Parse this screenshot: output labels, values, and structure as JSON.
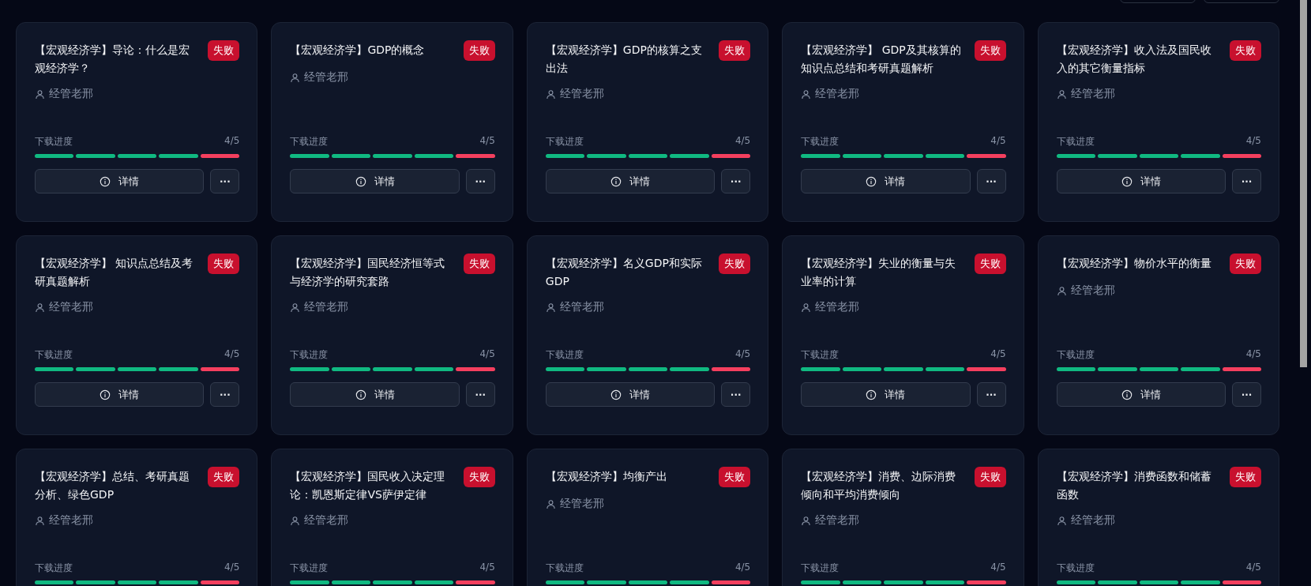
{
  "toolbar": {
    "buttons": [
      {
        "kind": "outline"
      },
      {
        "kind": "outline"
      }
    ]
  },
  "cards": [
    {
      "title": "【宏观经济学】导论：什么是宏观经济学？",
      "failed": true,
      "status_label": "失败",
      "author": "经管老邢",
      "progress_label": "下载进度",
      "progress_text": "4/5",
      "segments": [
        {
          "failed": false
        },
        {
          "failed": false
        },
        {
          "failed": false
        },
        {
          "failed": false
        },
        {
          "failed": true
        }
      ],
      "details_label": "详情",
      "more_label": "···"
    },
    {
      "title": "【宏观经济学】GDP的概念",
      "failed": true,
      "status_label": "失败",
      "author": "经管老邢",
      "progress_label": "下载进度",
      "progress_text": "4/5",
      "segments": [
        {
          "failed": false
        },
        {
          "failed": false
        },
        {
          "failed": false
        },
        {
          "failed": false
        },
        {
          "failed": true
        }
      ],
      "details_label": "详情",
      "more_label": "···"
    },
    {
      "title": "【宏观经济学】GDP的核算之支出法",
      "failed": true,
      "status_label": "失败",
      "author": "经管老邢",
      "progress_label": "下载进度",
      "progress_text": "4/5",
      "segments": [
        {
          "failed": false
        },
        {
          "failed": false
        },
        {
          "failed": false
        },
        {
          "failed": false
        },
        {
          "failed": true
        }
      ],
      "details_label": "详情",
      "more_label": "···"
    },
    {
      "title": "【宏观经济学】 GDP及其核算的知识点总结和考研真题解析",
      "failed": true,
      "status_label": "失败",
      "author": "经管老邢",
      "progress_label": "下载进度",
      "progress_text": "4/5",
      "segments": [
        {
          "failed": false
        },
        {
          "failed": false
        },
        {
          "failed": false
        },
        {
          "failed": false
        },
        {
          "failed": true
        }
      ],
      "details_label": "详情",
      "more_label": "···"
    },
    {
      "title": "【宏观经济学】收入法及国民收入的其它衡量指标",
      "failed": true,
      "status_label": "失败",
      "author": "经管老邢",
      "progress_label": "下载进度",
      "progress_text": "4/5",
      "segments": [
        {
          "failed": false
        },
        {
          "failed": false
        },
        {
          "failed": false
        },
        {
          "failed": false
        },
        {
          "failed": true
        }
      ],
      "details_label": "详情",
      "more_label": "···"
    },
    {
      "title": "【宏观经济学】 知识点总结及考研真题解析",
      "failed": true,
      "status_label": "失败",
      "author": "经管老邢",
      "progress_label": "下载进度",
      "progress_text": "4/5",
      "segments": [
        {
          "failed": false
        },
        {
          "failed": false
        },
        {
          "failed": false
        },
        {
          "failed": false
        },
        {
          "failed": true
        }
      ],
      "details_label": "详情",
      "more_label": "···"
    },
    {
      "title": "【宏观经济学】国民经济恒等式与经济学的研究套路",
      "failed": true,
      "status_label": "失败",
      "author": "经管老邢",
      "progress_label": "下载进度",
      "progress_text": "4/5",
      "segments": [
        {
          "failed": false
        },
        {
          "failed": false
        },
        {
          "failed": false
        },
        {
          "failed": false
        },
        {
          "failed": true
        }
      ],
      "details_label": "详情",
      "more_label": "···"
    },
    {
      "title": "【宏观经济学】名义GDP和实际GDP",
      "failed": true,
      "status_label": "失败",
      "author": "经管老邢",
      "progress_label": "下载进度",
      "progress_text": "4/5",
      "segments": [
        {
          "failed": false
        },
        {
          "failed": false
        },
        {
          "failed": false
        },
        {
          "failed": false
        },
        {
          "failed": true
        }
      ],
      "details_label": "详情",
      "more_label": "···"
    },
    {
      "title": "【宏观经济学】失业的衡量与失业率的计算",
      "failed": true,
      "status_label": "失败",
      "author": "经管老邢",
      "progress_label": "下载进度",
      "progress_text": "4/5",
      "segments": [
        {
          "failed": false
        },
        {
          "failed": false
        },
        {
          "failed": false
        },
        {
          "failed": false
        },
        {
          "failed": true
        }
      ],
      "details_label": "详情",
      "more_label": "···"
    },
    {
      "title": "【宏观经济学】物价水平的衡量",
      "failed": true,
      "status_label": "失败",
      "author": "经管老邢",
      "progress_label": "下载进度",
      "progress_text": "4/5",
      "segments": [
        {
          "failed": false
        },
        {
          "failed": false
        },
        {
          "failed": false
        },
        {
          "failed": false
        },
        {
          "failed": true
        }
      ],
      "details_label": "详情",
      "more_label": "···"
    },
    {
      "title": "【宏观经济学】总结、考研真题分析、绿色GDP",
      "failed": true,
      "status_label": "失败",
      "author": "经管老邢",
      "progress_label": "下载进度",
      "progress_text": "4/5",
      "segments": [
        {
          "failed": false
        },
        {
          "failed": false
        },
        {
          "failed": false
        },
        {
          "failed": false
        },
        {
          "failed": true
        }
      ]
    },
    {
      "title": "【宏观经济学】国民收入决定理论：凯恩斯定律VS萨伊定律",
      "failed": true,
      "status_label": "失败",
      "author": "经管老邢",
      "progress_label": "下载进度",
      "progress_text": "4/5",
      "segments": [
        {
          "failed": false
        },
        {
          "failed": false
        },
        {
          "failed": false
        },
        {
          "failed": false
        },
        {
          "failed": true
        }
      ]
    },
    {
      "title": "【宏观经济学】均衡产出",
      "failed": true,
      "status_label": "失败",
      "author": "经管老邢",
      "progress_label": "下载进度",
      "progress_text": "4/5",
      "segments": [
        {
          "failed": false
        },
        {
          "failed": false
        },
        {
          "failed": false
        },
        {
          "failed": false
        },
        {
          "failed": true
        }
      ]
    },
    {
      "title": "【宏观经济学】消费、边际消费倾向和平均消费倾向",
      "failed": true,
      "status_label": "失败",
      "author": "经管老邢",
      "progress_label": "下载进度",
      "progress_text": "4/5",
      "segments": [
        {
          "failed": false
        },
        {
          "failed": false
        },
        {
          "failed": false
        },
        {
          "failed": false
        },
        {
          "failed": true
        }
      ]
    },
    {
      "title": "【宏观经济学】消费函数和储蓄函数",
      "failed": true,
      "status_label": "失败",
      "author": "经管老邢",
      "progress_label": "下载进度",
      "progress_text": "4/5",
      "segments": [
        {
          "failed": false
        },
        {
          "failed": false
        },
        {
          "failed": false
        },
        {
          "failed": false
        },
        {
          "failed": true
        }
      ]
    }
  ]
}
